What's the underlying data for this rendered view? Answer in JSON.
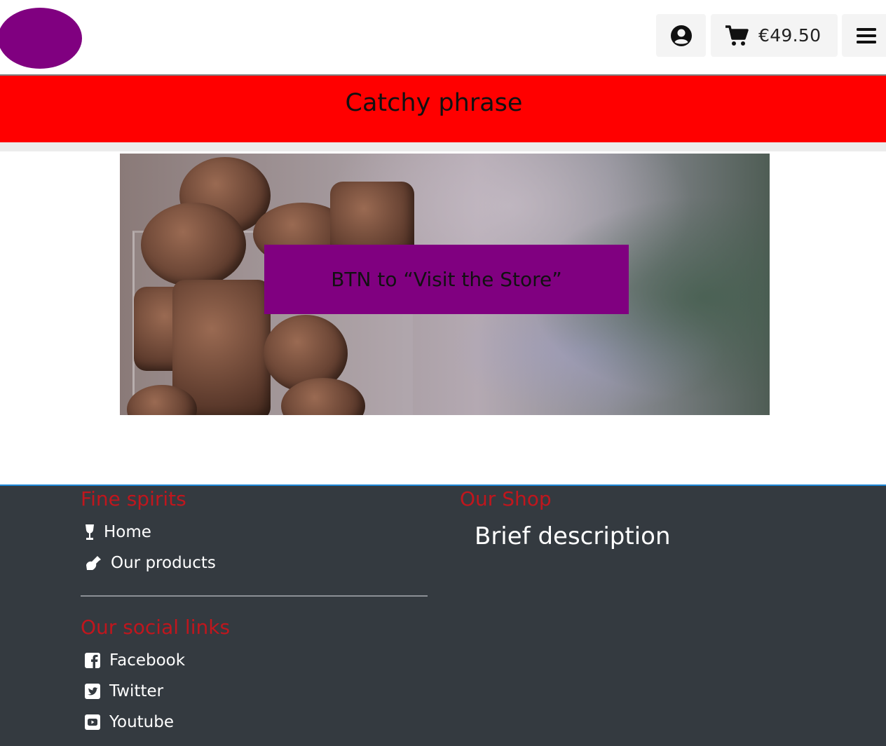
{
  "header": {
    "logo": "logo-placeholder",
    "account_icon": "user-circle-icon",
    "cart_icon": "shopping-cart-icon",
    "cart_total": "€49.50",
    "menu_icon": "hamburger-menu-icon"
  },
  "banner": {
    "text": "Catchy phrase",
    "color": "#ff0000"
  },
  "hero": {
    "image": "wine-corks-in-glass-jar",
    "button_label": "BTN to “Visit the Store”",
    "button_color": "#800080"
  },
  "footer": {
    "brand_heading": "Fine spirits",
    "nav_links": [
      {
        "icon": "wine-glass-icon",
        "label": "Home"
      },
      {
        "icon": "wine-bottle-icon",
        "label": "Our products"
      }
    ],
    "social_heading": "Our social links",
    "social_links": [
      {
        "icon": "facebook-square-icon",
        "label": "Facebook"
      },
      {
        "icon": "twitter-square-icon",
        "label": "Twitter"
      },
      {
        "icon": "youtube-square-icon",
        "label": "Youtube"
      }
    ],
    "shop_heading": "Our Shop",
    "shop_description": "Brief description",
    "heading_color": "#c0161d",
    "background": "#343a40"
  }
}
